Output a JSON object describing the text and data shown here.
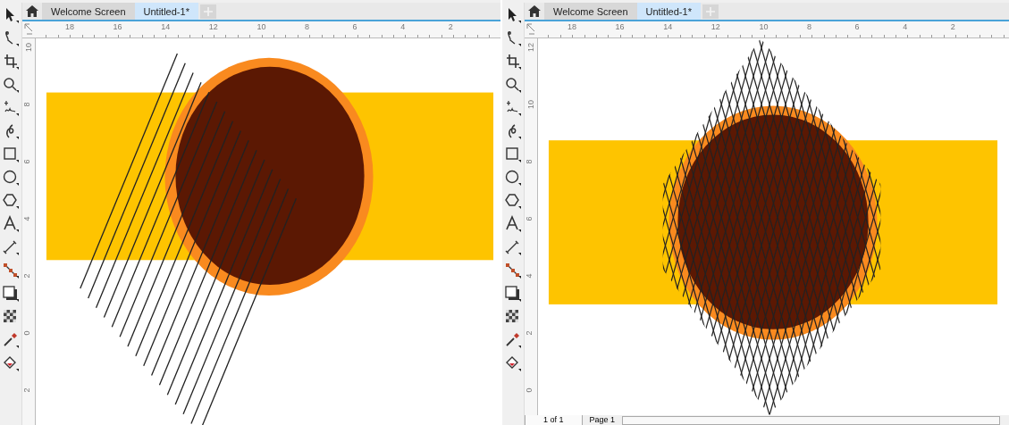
{
  "panels": [
    {
      "tabs": [
        {
          "label": "Welcome Screen",
          "selected": false
        },
        {
          "label": "Untitled-1*",
          "selected": true
        }
      ],
      "ruler": {
        "horizontal": [
          "18",
          "16",
          "14",
          "12",
          "10",
          "8",
          "6",
          "4",
          "2"
        ],
        "vertical": [
          "10",
          "8",
          "6",
          "4",
          "2",
          "0",
          "2"
        ]
      },
      "artwork": {
        "kind": "parallel"
      }
    },
    {
      "tabs": [
        {
          "label": "Welcome Screen",
          "selected": false
        },
        {
          "label": "Untitled-1*",
          "selected": true
        }
      ],
      "ruler": {
        "horizontal": [
          "18",
          "16",
          "14",
          "12",
          "10",
          "8",
          "6",
          "4",
          "2"
        ],
        "vertical": [
          "12",
          "10",
          "8",
          "6",
          "4",
          "2",
          "0"
        ]
      },
      "artwork": {
        "kind": "crosshatch"
      },
      "page_nav": {
        "count": "1 of 1",
        "page_tab": "Page 1"
      }
    }
  ]
}
